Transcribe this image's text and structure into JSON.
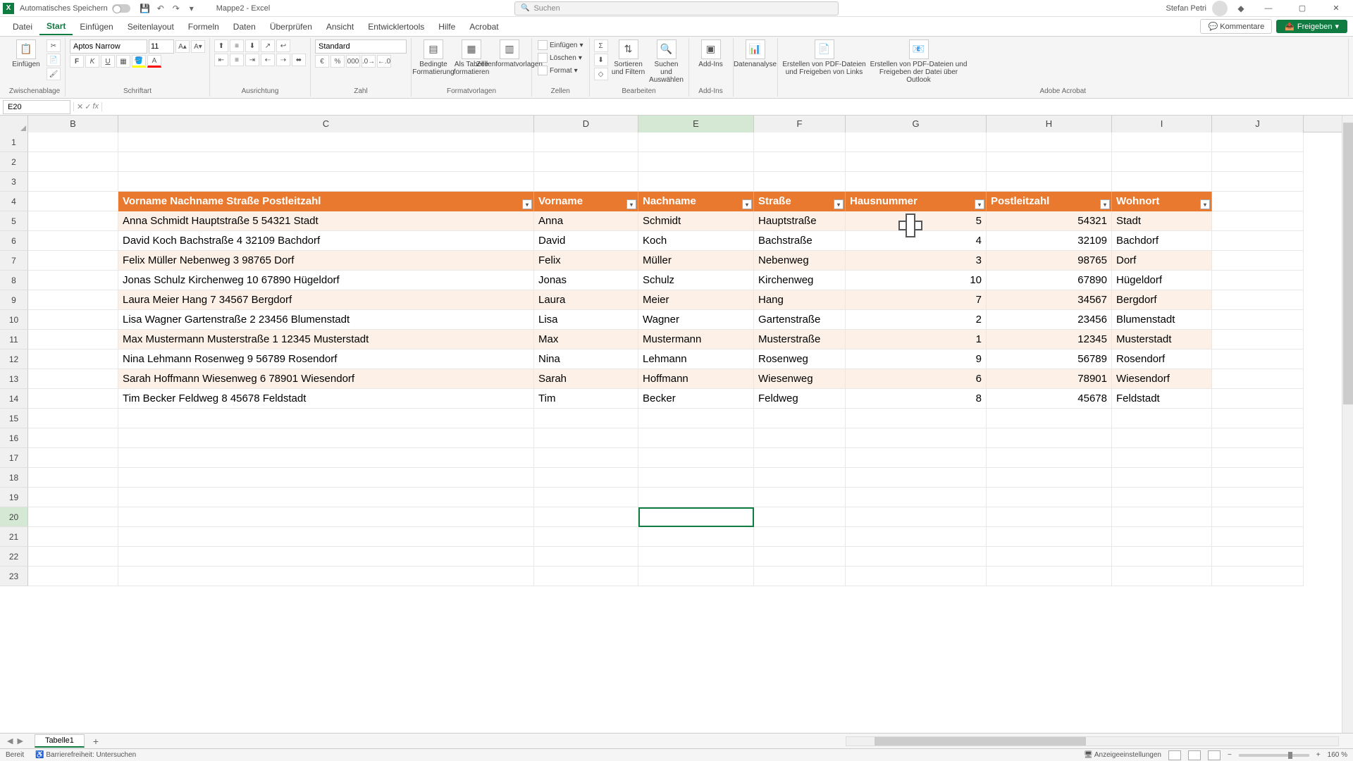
{
  "titlebar": {
    "autosave": "Automatisches Speichern",
    "doc": "Mappe2 - Excel",
    "search_placeholder": "Suchen",
    "user": "Stefan Petri"
  },
  "tabs": {
    "file": "Datei",
    "home": "Start",
    "insert": "Einfügen",
    "layout": "Seitenlayout",
    "formulas": "Formeln",
    "data": "Daten",
    "review": "Überprüfen",
    "view": "Ansicht",
    "developer": "Entwicklertools",
    "help": "Hilfe",
    "acrobat": "Acrobat",
    "comments": "Kommentare",
    "share": "Freigeben"
  },
  "ribbon": {
    "paste": "Einfügen",
    "clipboard": "Zwischenablage",
    "font_name": "Aptos Narrow",
    "font_size": "11",
    "font_group": "Schriftart",
    "align_group": "Ausrichtung",
    "num_format": "Standard",
    "num_group": "Zahl",
    "cond_format": "Bedingte Formatierung",
    "as_table": "Als Tabelle formatieren",
    "cell_styles": "Zellenformatvorlagen",
    "styles_group": "Formatvorlagen",
    "insert_cells": "Einfügen",
    "delete_cells": "Löschen",
    "format_cells": "Format",
    "cells_group": "Zellen",
    "sort_filter": "Sortieren und Filtern",
    "find_select": "Suchen und Auswählen",
    "edit_group": "Bearbeiten",
    "addins": "Add-Ins",
    "addins_group": "Add-Ins",
    "data_analysis": "Datenanalyse",
    "pdf1": "Erstellen von PDF-Dateien und Freigeben von Links",
    "pdf2": "Erstellen von PDF-Dateien und Freigeben der Datei über Outlook",
    "acrobat_group": "Adobe Acrobat"
  },
  "namebox": "E20",
  "columns": [
    "B",
    "C",
    "D",
    "E",
    "F",
    "G",
    "H",
    "I",
    "J"
  ],
  "headers": {
    "combined": "Vorname Nachname Straße Postleitzahl",
    "vorname": "Vorname",
    "nachname": "Nachname",
    "strasse": "Straße",
    "hausnummer": "Hausnummer",
    "plz": "Postleitzahl",
    "wohnort": "Wohnort"
  },
  "rows": [
    {
      "c": "Anna Schmidt Hauptstraße 5 54321 Stadt",
      "d": "Anna",
      "e": "Schmidt",
      "f": "Hauptstraße",
      "g": "5",
      "h": "54321",
      "i": "Stadt"
    },
    {
      "c": "David Koch Bachstraße 4 32109 Bachdorf",
      "d": "David",
      "e": "Koch",
      "f": "Bachstraße",
      "g": "4",
      "h": "32109",
      "i": "Bachdorf"
    },
    {
      "c": "Felix Müller Nebenweg 3 98765 Dorf",
      "d": "Felix",
      "e": "Müller",
      "f": "Nebenweg",
      "g": "3",
      "h": "98765",
      "i": "Dorf"
    },
    {
      "c": "Jonas Schulz Kirchenweg 10 67890 Hügeldorf",
      "d": "Jonas",
      "e": "Schulz",
      "f": "Kirchenweg",
      "g": "10",
      "h": "67890",
      "i": "Hügeldorf"
    },
    {
      "c": "Laura Meier Hang 7 34567 Bergdorf",
      "d": "Laura",
      "e": "Meier",
      "f": "Hang",
      "g": "7",
      "h": "34567",
      "i": "Bergdorf"
    },
    {
      "c": "Lisa Wagner Gartenstraße 2 23456 Blumenstadt",
      "d": "Lisa",
      "e": "Wagner",
      "f": "Gartenstraße",
      "g": "2",
      "h": "23456",
      "i": "Blumenstadt"
    },
    {
      "c": "Max Mustermann Musterstraße 1 12345 Musterstadt",
      "d": "Max",
      "e": "Mustermann",
      "f": "Musterstraße",
      "g": "1",
      "h": "12345",
      "i": "Musterstadt"
    },
    {
      "c": "Nina Lehmann Rosenweg 9 56789 Rosendorf",
      "d": "Nina",
      "e": "Lehmann",
      "f": "Rosenweg",
      "g": "9",
      "h": "56789",
      "i": "Rosendorf"
    },
    {
      "c": "Sarah Hoffmann Wiesenweg 6 78901 Wiesendorf",
      "d": "Sarah",
      "e": "Hoffmann",
      "f": "Wiesenweg",
      "g": "6",
      "h": "78901",
      "i": "Wiesendorf"
    },
    {
      "c": "Tim Becker Feldweg 8 45678 Feldstadt",
      "d": "Tim",
      "e": "Becker",
      "f": "Feldweg",
      "g": "8",
      "h": "45678",
      "i": "Feldstadt"
    }
  ],
  "sheet": {
    "name": "Tabelle1"
  },
  "status": {
    "ready": "Bereit",
    "accessibility": "Barrierefreiheit: Untersuchen",
    "display": "Anzeigeeinstellungen",
    "zoom": "160 %"
  }
}
